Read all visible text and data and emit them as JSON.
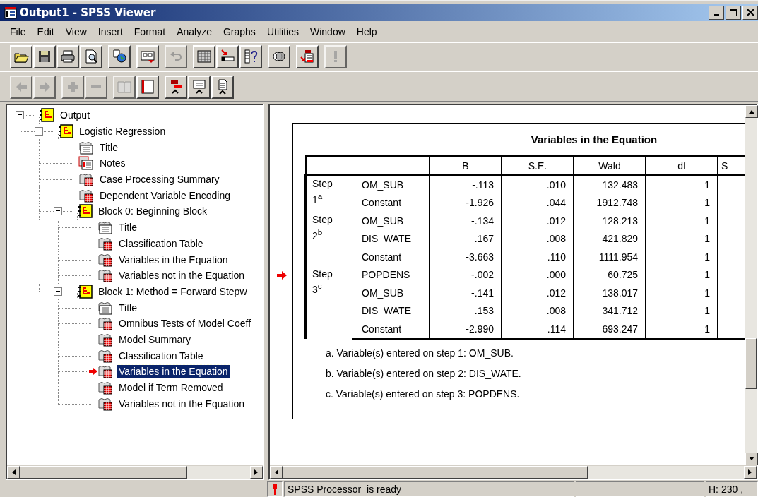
{
  "window": {
    "title": "Output1 - SPSS Viewer"
  },
  "menu": [
    "File",
    "Edit",
    "View",
    "Insert",
    "Format",
    "Analyze",
    "Graphs",
    "Utilities",
    "Window",
    "Help"
  ],
  "toolbars": [
    [
      [
        {
          "kind": "open",
          "disabled": false
        },
        {
          "kind": "save",
          "disabled": false
        },
        {
          "kind": "print",
          "disabled": false
        },
        {
          "kind": "preview",
          "disabled": false
        }
      ],
      [
        {
          "kind": "export",
          "disabled": false
        }
      ],
      [
        {
          "kind": "recall",
          "disabled": false
        }
      ],
      [
        {
          "kind": "undo",
          "disabled": true
        }
      ],
      [
        {
          "kind": "data",
          "disabled": false
        },
        {
          "kind": "case",
          "disabled": false
        },
        {
          "kind": "vars",
          "disabled": false
        }
      ],
      [
        {
          "kind": "sets",
          "disabled": false
        }
      ],
      [
        {
          "kind": "designate",
          "disabled": false
        }
      ],
      [
        {
          "kind": "run",
          "disabled": true
        }
      ]
    ],
    [
      [
        {
          "kind": "back",
          "disabled": true
        },
        {
          "kind": "forward",
          "disabled": true
        }
      ],
      [
        {
          "kind": "expand",
          "disabled": true
        },
        {
          "kind": "collapse",
          "disabled": true
        }
      ],
      [
        {
          "kind": "show",
          "disabled": true
        },
        {
          "kind": "hide",
          "disabled": false
        }
      ],
      [
        {
          "kind": "promote",
          "disabled": false
        },
        {
          "kind": "demote",
          "disabled": false
        },
        {
          "kind": "insert",
          "disabled": false
        }
      ]
    ]
  ],
  "outline": [
    {
      "label": "Output",
      "kind": "folder",
      "selected": false,
      "expanded": true,
      "children": [
        {
          "label": "Logistic Regression",
          "kind": "folder",
          "selected": false,
          "expanded": true,
          "children": [
            {
              "label": "Title",
              "kind": "title",
              "selected": false
            },
            {
              "label": "Notes",
              "kind": "notes",
              "selected": false
            },
            {
              "label": "Case Processing Summary",
              "kind": "table",
              "selected": false
            },
            {
              "label": "Dependent Variable Encoding",
              "kind": "table",
              "selected": false
            },
            {
              "label": "Block 0: Beginning Block",
              "kind": "folder",
              "selected": false,
              "expanded": true,
              "children": [
                {
                  "label": "Title",
                  "kind": "title",
                  "selected": false
                },
                {
                  "label": "Classification Table",
                  "kind": "table",
                  "selected": false
                },
                {
                  "label": "Variables in the Equation",
                  "kind": "table",
                  "selected": false
                },
                {
                  "label": "Variables not in the Equation",
                  "kind": "table",
                  "selected": false
                }
              ]
            },
            {
              "label": "Block 1: Method = Forward Stepw",
              "kind": "folder",
              "selected": false,
              "expanded": true,
              "children": [
                {
                  "label": "Title",
                  "kind": "title",
                  "selected": false
                },
                {
                  "label": "Omnibus Tests of Model Coeff",
                  "kind": "table",
                  "selected": false
                },
                {
                  "label": "Model Summary",
                  "kind": "table",
                  "selected": false
                },
                {
                  "label": "Classification Table",
                  "kind": "table",
                  "selected": false
                },
                {
                  "label": "Variables in the Equation",
                  "kind": "table",
                  "selected": true
                },
                {
                  "label": "Model if Term Removed",
                  "kind": "table",
                  "selected": false
                },
                {
                  "label": "Variables not in the Equation",
                  "kind": "table",
                  "selected": false
                }
              ]
            }
          ]
        }
      ]
    }
  ],
  "table": {
    "title": "Variables in the Equation",
    "columns": [
      "B",
      "S.E.",
      "Wald",
      "df",
      "S"
    ],
    "steps": [
      {
        "label": "Step",
        "number": "1$^{a}$",
        "rows": [
          {
            "variable": "OM_SUB",
            "values": [
              "-.113",
              ".010",
              "132.483",
              "1"
            ]
          },
          {
            "variable": "Constant",
            "values": [
              "-1.926",
              ".044",
              "1912.748",
              "1"
            ]
          }
        ]
      },
      {
        "label": "Step",
        "number": "2$^{b}$",
        "rows": [
          {
            "variable": "OM_SUB",
            "values": [
              "-.134",
              ".012",
              "128.213",
              "1"
            ]
          },
          {
            "variable": "DIS_WATE",
            "values": [
              ".167",
              ".008",
              "421.829",
              "1"
            ]
          },
          {
            "variable": "Constant",
            "values": [
              "-3.663",
              ".110",
              "1111.954",
              "1"
            ]
          }
        ]
      },
      {
        "label": "Step",
        "number": "3$^{c}$",
        "rows": [
          {
            "variable": "POPDENS",
            "values": [
              "-.002",
              ".000",
              "60.725",
              "1"
            ]
          },
          {
            "variable": "OM_SUB",
            "values": [
              "-.141",
              ".012",
              "138.017",
              "1"
            ]
          },
          {
            "variable": "DIS_WATE",
            "values": [
              ".153",
              ".008",
              "341.712",
              "1"
            ]
          },
          {
            "variable": "Constant",
            "values": [
              "-2.990",
              ".114",
              "693.247",
              "1"
            ]
          }
        ]
      }
    ],
    "footnotes": [
      "a. Variable(s) entered on step 1: OM_SUB.",
      "b. Variable(s) entered on step 2: DIS_WATE.",
      "c. Variable(s) entered on step 3: POPDENS."
    ]
  },
  "status_bar": {
    "message": "SPSS Processor  is ready",
    "position": "H: 230 ,"
  }
}
